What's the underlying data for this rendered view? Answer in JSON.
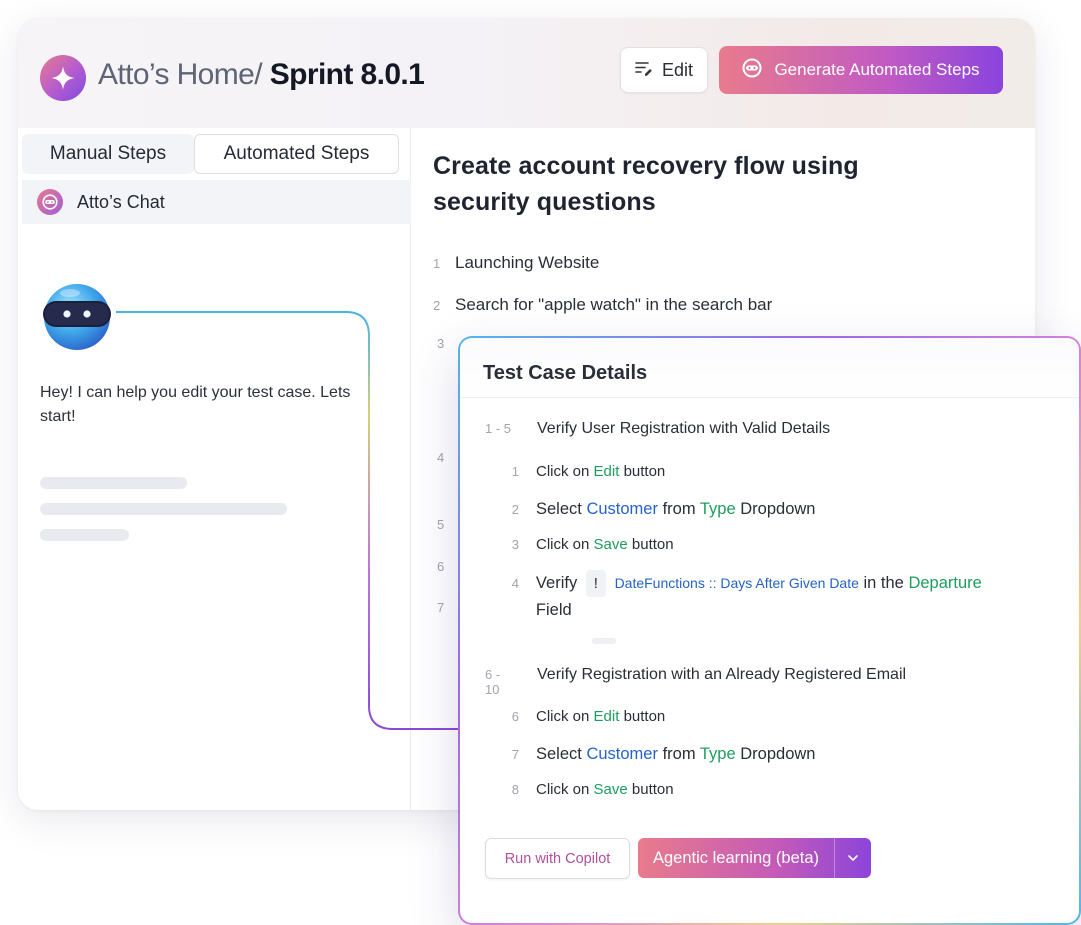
{
  "header": {
    "breadcrumb": "Atto’s Home/",
    "title": "Sprint 8.0.1",
    "edit_label": "Edit",
    "generate_label": "Generate Automated Steps"
  },
  "sidebar": {
    "tabs": [
      {
        "label": "Manual Steps"
      },
      {
        "label": "Automated Steps"
      }
    ],
    "chat_title": "Atto’s Chat",
    "chat_message": "Hey! I can help you edit your test case. Lets start!"
  },
  "main": {
    "title": "Create account recovery flow using security questions",
    "steps": [
      {
        "num": "1",
        "text": "Launching Website"
      },
      {
        "num": "2",
        "text": "Search for \"apple watch\" in the search bar"
      }
    ],
    "hidden_step_numbers": [
      "3",
      "4",
      "5",
      "6",
      "7"
    ]
  },
  "modal": {
    "title": "Test Case Details",
    "groups": [
      {
        "range": "1 - 5",
        "title": "Verify User Registration with Valid Details",
        "items": [
          {
            "num": "1",
            "pre": "Click on",
            "kw": "Edit",
            "post": "button"
          },
          {
            "num": "2",
            "pre": "Select",
            "kw1": "Customer",
            "mid": "from",
            "kw2": "Type",
            "post": "Dropdown"
          },
          {
            "num": "3",
            "pre": "Click on",
            "kw": "Save",
            "post": "button"
          },
          {
            "num": "4",
            "pre": "Verify",
            "pill": "!",
            "fn": "DateFunctions :: Days After Given Date",
            "mid": "in the",
            "kw": "Departure",
            "post": "Field"
          }
        ]
      },
      {
        "range": "6 - 10",
        "title": "Verify Registration with an Already Registered Email",
        "items": [
          {
            "num": "6",
            "pre": "Click on",
            "kw": "Edit",
            "post": "button"
          },
          {
            "num": "7",
            "pre": "Select",
            "kw1": "Customer",
            "mid": "from",
            "kw2": "Type",
            "post": "Dropdown"
          },
          {
            "num": "8",
            "pre": "Click on",
            "kw": "Save",
            "post": "button"
          }
        ]
      }
    ],
    "copilot_label": "Run with Copilot",
    "agentic_label": "Agentic learning (beta)"
  },
  "icons": {
    "logo": "sparkle-icon",
    "edit": "edit-lines-icon",
    "generate": "robot-head-icon",
    "dropdown": "chevron-down-icon"
  },
  "colors": {
    "accent_start": "#e87b8c",
    "accent_end": "#8a44dc",
    "keyword_green": "#1f9c5e",
    "keyword_blue": "#2563c9"
  }
}
